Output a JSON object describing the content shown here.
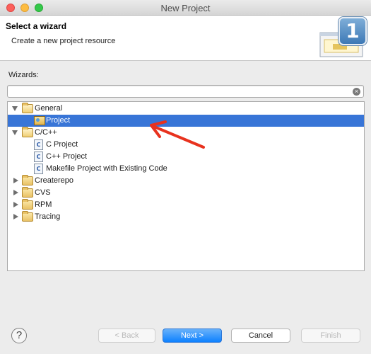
{
  "window": {
    "title": "New Project"
  },
  "step_badge": "1",
  "header": {
    "title": "Select a wizard",
    "description": "Create a new project resource"
  },
  "wizards_label": "Wizards:",
  "filter": {
    "value": "",
    "placeholder": ""
  },
  "tree": [
    {
      "label": "General",
      "level": 0,
      "expanded": true,
      "icon": "folder-icon"
    },
    {
      "label": "Project",
      "level": 1,
      "selected": true,
      "icon": "project-icon"
    },
    {
      "label": "C/C++",
      "level": 0,
      "expanded": true,
      "icon": "folder-icon"
    },
    {
      "label": "C Project",
      "level": 1,
      "icon": "c-project-icon"
    },
    {
      "label": "C++ Project",
      "level": 1,
      "icon": "cpp-project-icon"
    },
    {
      "label": "Makefile Project with Existing Code",
      "level": 1,
      "icon": "makefile-project-icon"
    },
    {
      "label": "Createrepo",
      "level": 0,
      "expanded": false,
      "icon": "folder-icon"
    },
    {
      "label": "CVS",
      "level": 0,
      "expanded": false,
      "icon": "folder-icon"
    },
    {
      "label": "RPM",
      "level": 0,
      "expanded": false,
      "icon": "folder-icon"
    },
    {
      "label": "Tracing",
      "level": 0,
      "expanded": false,
      "icon": "folder-icon"
    }
  ],
  "buttons": {
    "help": "?",
    "back": "< Back",
    "next": "Next >",
    "cancel": "Cancel",
    "finish": "Finish"
  },
  "colors": {
    "selection": "#3875d7",
    "primary_button": "#0d81ff",
    "annotation_arrow": "#e8321e"
  }
}
